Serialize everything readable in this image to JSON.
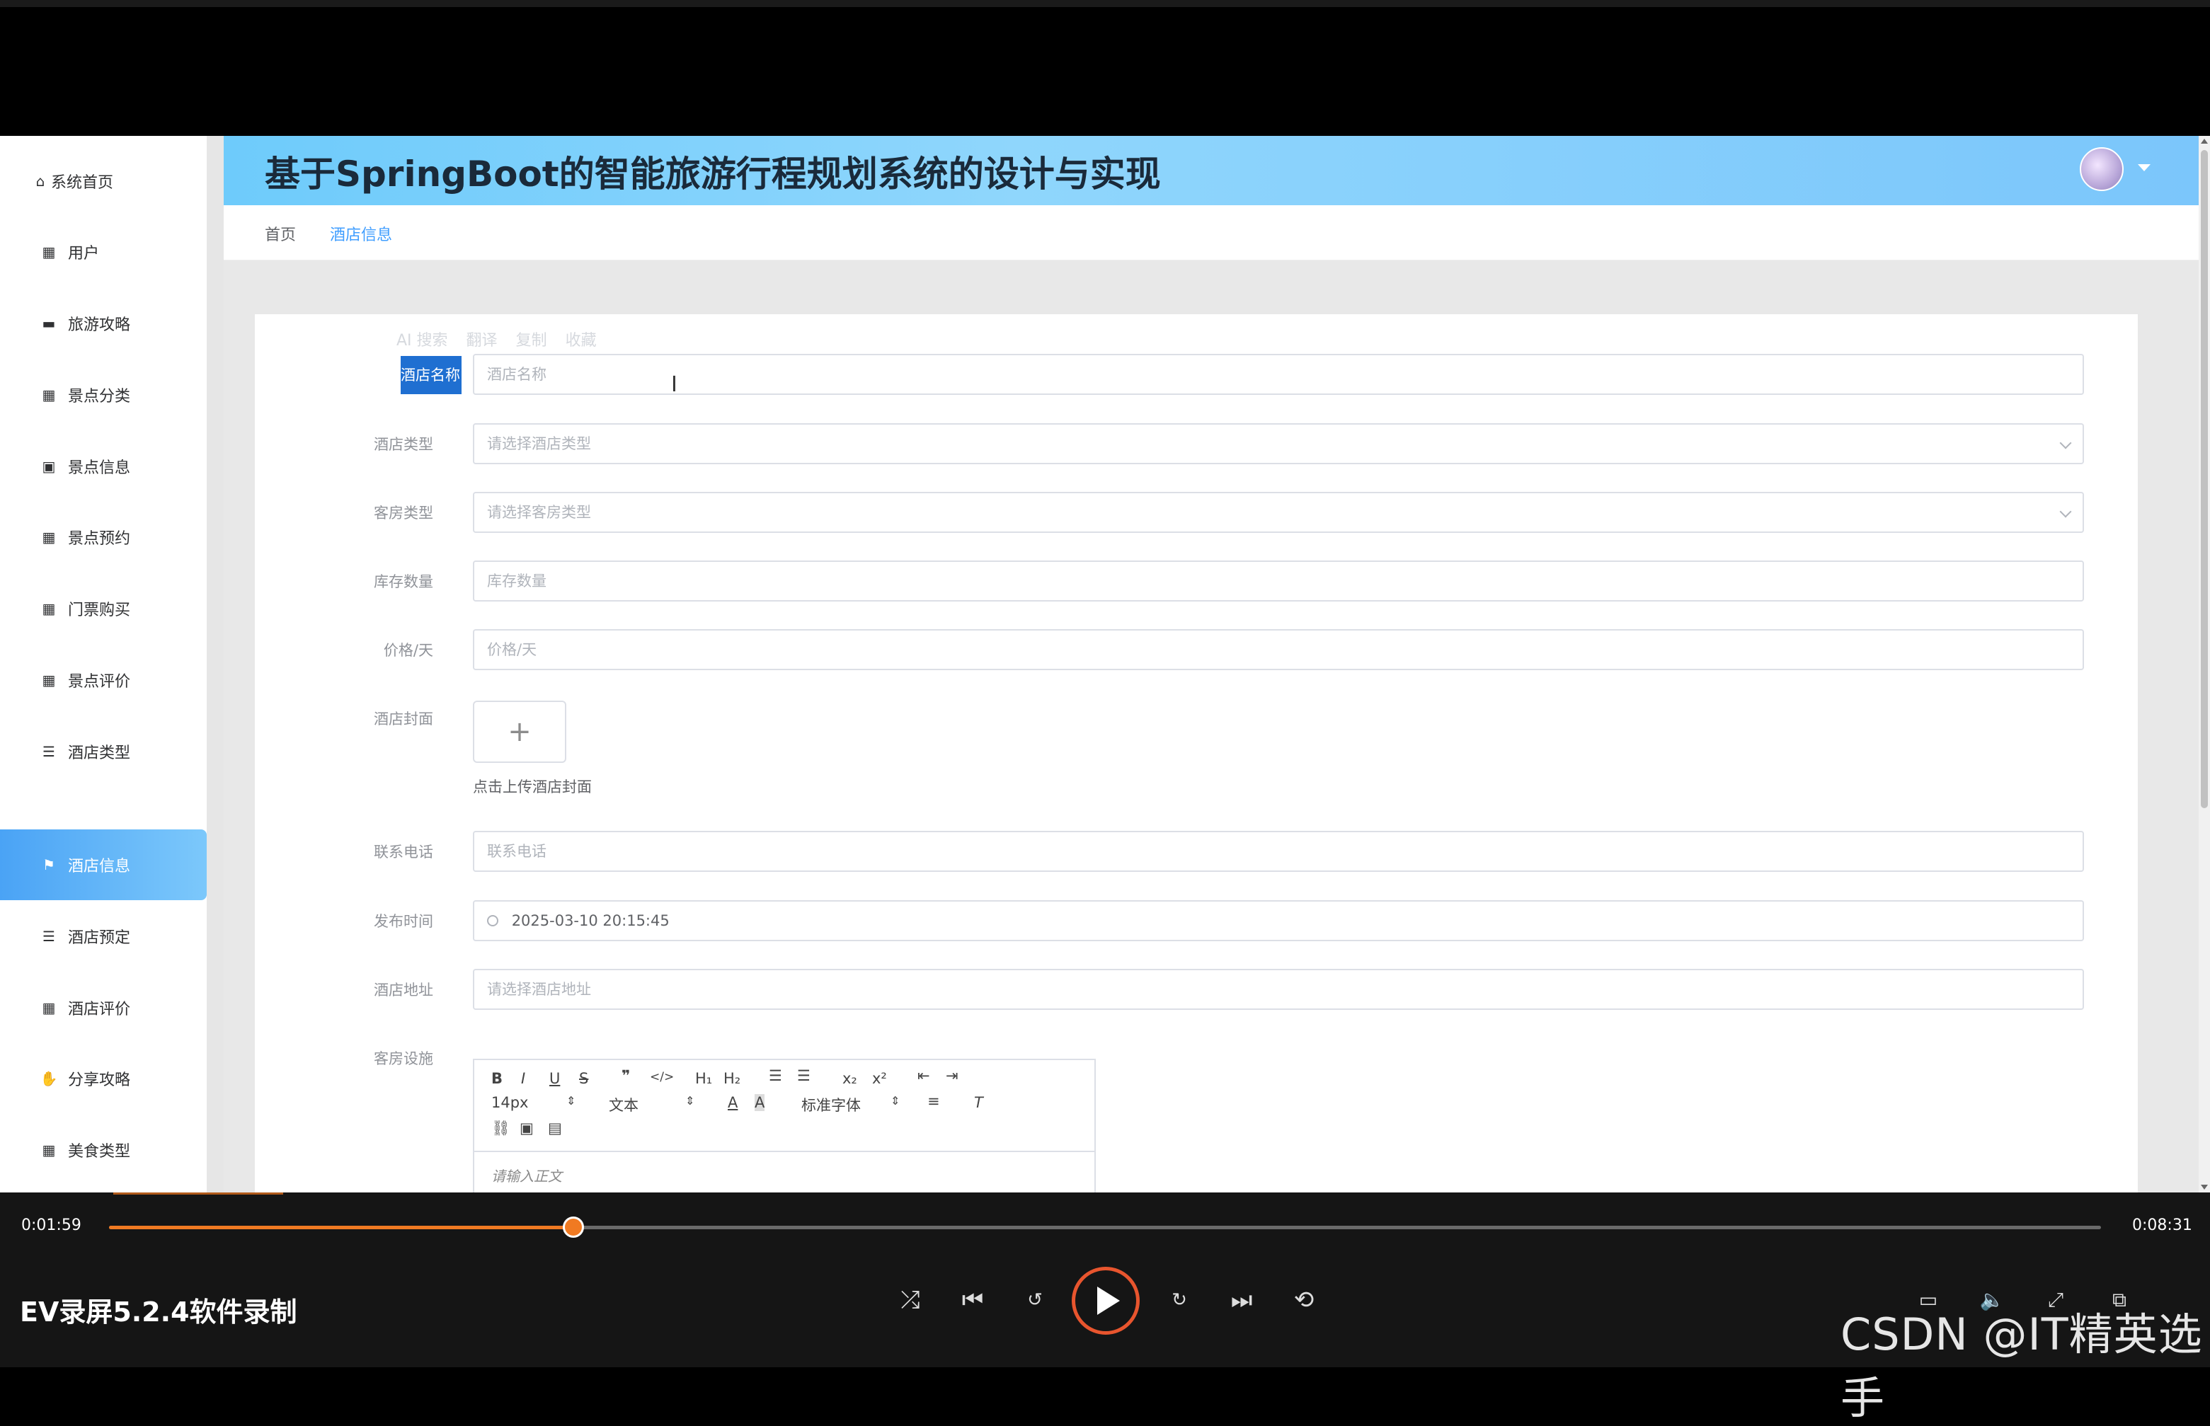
{
  "app": {
    "title": "基于SpringBoot的智能旅游行程规划系统的设计与实现"
  },
  "sidebar": {
    "items": [
      {
        "label": "系统首页",
        "icon": "home-icon"
      },
      {
        "label": "用户",
        "icon": "grid-icon"
      },
      {
        "label": "旅游攻略",
        "icon": "book-icon"
      },
      {
        "label": "景点分类",
        "icon": "grid-icon"
      },
      {
        "label": "景点信息",
        "icon": "clipboard-icon"
      },
      {
        "label": "景点预约",
        "icon": "grid-icon"
      },
      {
        "label": "门票购买",
        "icon": "grid-icon"
      },
      {
        "label": "景点评价",
        "icon": "grid-icon"
      },
      {
        "label": "酒店类型",
        "icon": "list-icon"
      },
      {
        "label": "酒店信息",
        "icon": "flag-icon",
        "active": true
      },
      {
        "label": "酒店预定",
        "icon": "list-icon"
      },
      {
        "label": "酒店评价",
        "icon": "grid-icon"
      },
      {
        "label": "分享攻略",
        "icon": "thumb-icon"
      },
      {
        "label": "美食类型",
        "icon": "grid-icon"
      }
    ]
  },
  "breadcrumb": {
    "home": "首页",
    "current": "酒店信息"
  },
  "ghost_toolbar": {
    "ai_search": "AI 搜索",
    "translate": "翻译",
    "copy": "复制",
    "favorite": "收藏"
  },
  "form": {
    "hotel_name": {
      "label": "酒店名称",
      "placeholder": "酒店名称"
    },
    "hotel_type": {
      "label": "酒店类型",
      "placeholder": "请选择酒店类型"
    },
    "room_type": {
      "label": "客房类型",
      "placeholder": "请选择客房类型"
    },
    "stock": {
      "label": "库存数量",
      "placeholder": "库存数量"
    },
    "price": {
      "label": "价格/天",
      "placeholder": "价格/天"
    },
    "cover": {
      "label": "酒店封面",
      "tip": "点击上传酒店封面",
      "plus": "+"
    },
    "phone": {
      "label": "联系电话",
      "placeholder": "联系电话"
    },
    "publish_time": {
      "label": "发布时间",
      "value": "2025-03-10 20:15:45"
    },
    "address": {
      "label": "酒店地址",
      "placeholder": "请选择酒店地址"
    },
    "facilities": {
      "label": "客房设施",
      "font_size": "14px",
      "text_style": "文本",
      "font_family": "标准字体",
      "placeholder": "请输入正文"
    }
  },
  "player": {
    "current_time": "0:01:59",
    "total_time": "0:08:31",
    "progress": 0.233,
    "app_name": "EV录屏5.2.4软件录制",
    "watermark": "CSDN @IT精英选手"
  },
  "colors": {
    "accent": "#409eff",
    "active_menu": "#4aa3f5",
    "progress": "#f07a22"
  }
}
